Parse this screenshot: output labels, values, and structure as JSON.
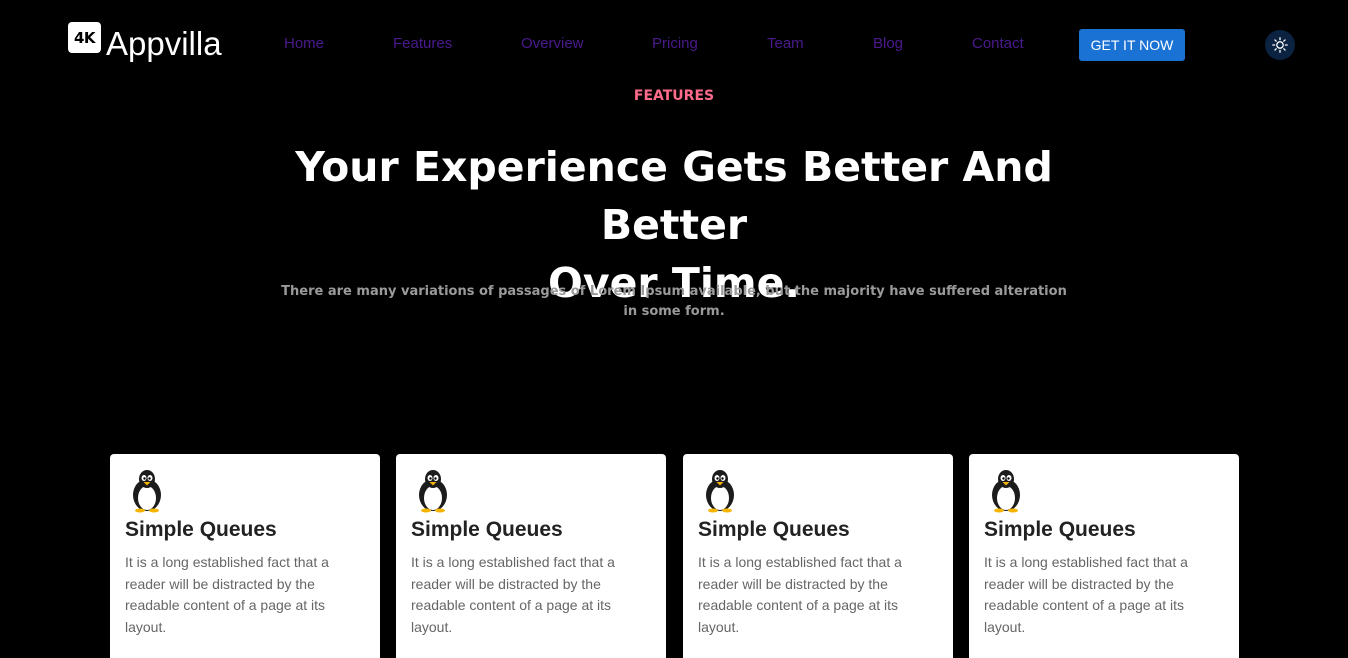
{
  "header": {
    "logo_badge": "4K",
    "logo_text": "Appvilla",
    "nav": [
      {
        "label": "Home"
      },
      {
        "label": "Features"
      },
      {
        "label": "Overview"
      },
      {
        "label": "Pricing"
      },
      {
        "label": "Team"
      },
      {
        "label": "Blog"
      },
      {
        "label": "Contact"
      }
    ],
    "cta_label": "GET IT NOW",
    "theme_icon": "sun-icon"
  },
  "section": {
    "eyebrow": "FEATURES",
    "headline_line1": "Your Experience Gets Better And Better",
    "headline_line2": "Over Time.",
    "subheading": "There are many variations of passages of Lorem Ipsum available, but the majority have suffered alteration in some form."
  },
  "cards": [
    {
      "icon": "penguin-icon",
      "title": "Simple Queues",
      "text": "It is a long established fact that a reader will be distracted by the readable content of a page at its layout."
    },
    {
      "icon": "penguin-icon",
      "title": "Simple Queues",
      "text": "It is a long established fact that a reader will be distracted by the readable content of a page at its layout."
    },
    {
      "icon": "penguin-icon",
      "title": "Simple Queues",
      "text": "It is a long established fact that a reader will be distracted by the readable content of a page at its layout."
    },
    {
      "icon": "penguin-icon",
      "title": "Simple Queues",
      "text": "It is a long established fact that a reader will be distracted by the readable content of a page at its layout."
    }
  ],
  "colors": {
    "background": "#000000",
    "nav_link": "#4a1a8c",
    "cta": "#1a73d4",
    "eyebrow": "#ff6b8a",
    "theme_toggle_bg": "#0b2240"
  }
}
